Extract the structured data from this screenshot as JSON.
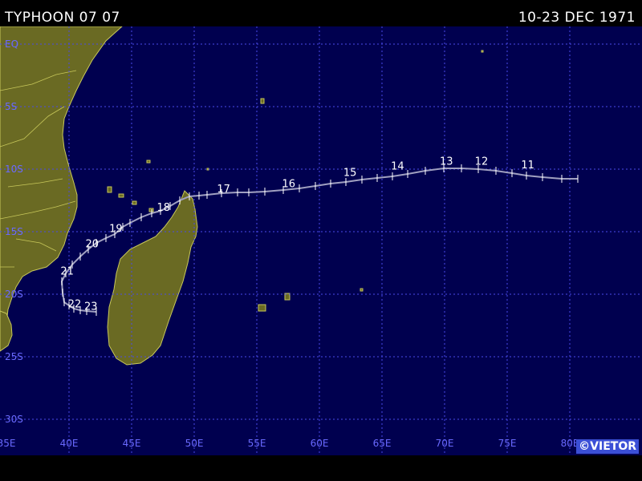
{
  "header": {
    "title": "TYPHOON 07 07",
    "date_range": "10-23 DEC 1971"
  },
  "credit": "©VIETOR",
  "colors": {
    "ocean": "#00004f",
    "land": "#6a6a23",
    "coast": "#c8c85a",
    "grid": "#4a4ae8",
    "grid_label": "#6a6aff",
    "track": "#a0a0c0",
    "marker": "#ffffff"
  },
  "axes": {
    "lat_labels": [
      "EQ",
      "5S",
      "10S",
      "15S",
      "20S",
      "25S",
      "30S"
    ],
    "lon_labels": [
      "35E",
      "40E",
      "45E",
      "50E",
      "55E",
      "60E",
      "65E",
      "70E",
      "75E",
      "80E"
    ]
  },
  "track_labels": [
    {
      "day": "11",
      "lon": 76.5,
      "lat": -10.2
    },
    {
      "day": "12",
      "lon": 72.8,
      "lat": -9.9
    },
    {
      "day": "13",
      "lon": 70.0,
      "lat": -9.9
    },
    {
      "day": "14",
      "lon": 66.1,
      "lat": -10.3
    },
    {
      "day": "15",
      "lon": 62.3,
      "lat": -10.8
    },
    {
      "day": "16",
      "lon": 57.4,
      "lat": -11.7
    },
    {
      "day": "17",
      "lon": 52.2,
      "lat": -12.1
    },
    {
      "day": "18",
      "lon": 47.4,
      "lat": -13.6
    },
    {
      "day": "19",
      "lon": 43.6,
      "lat": -15.3
    },
    {
      "day": "20",
      "lon": 41.7,
      "lat": -16.5
    },
    {
      "day": "21",
      "lon": 39.7,
      "lat": -18.7
    },
    {
      "day": "22",
      "lon": 40.3,
      "lat": -21.3
    },
    {
      "day": "23",
      "lon": 41.6,
      "lat": -21.5
    }
  ]
}
